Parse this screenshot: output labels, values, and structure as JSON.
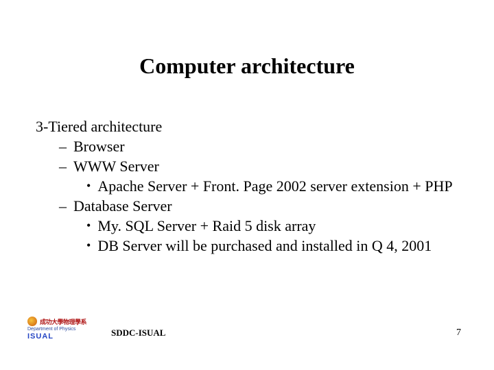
{
  "title": "Computer architecture",
  "body": {
    "lvl0_0": "3-Tiered architecture",
    "lvl1_0": "Browser",
    "lvl1_1": "WWW Server",
    "lvl2_0": "Apache Server + Front. Page 2002 server extension + PHP",
    "lvl1_2": "Database Server",
    "lvl2_1": "My. SQL Server + Raid 5 disk array",
    "lvl2_2": "DB Server will be purchased and installed in Q 4, 2001"
  },
  "footer": {
    "label": "SDDC-ISUAL",
    "page": "7",
    "logo_cn": "成功大學物理學系",
    "logo_dept": "Department of Physics",
    "logo_isual": "ISUAL"
  }
}
